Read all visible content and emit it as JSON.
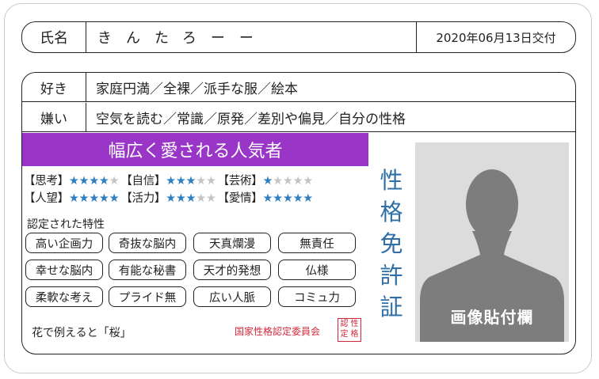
{
  "header": {
    "name_label": "氏名",
    "name_value": "きんたろーー",
    "issued": "2020年06月13日交付"
  },
  "likes": {
    "label": "好き",
    "value": "家庭円満／全裸／派手な服／絵本"
  },
  "dislikes": {
    "label": "嫌い",
    "value": "空気を読む／常識／原発／差別や偏見／自分の性格"
  },
  "banner": "幅広く愛される人気者",
  "ratings": [
    {
      "label": "【思考】",
      "stars": 4,
      "max": 5
    },
    {
      "label": "【自信】",
      "stars": 3,
      "max": 5
    },
    {
      "label": "【芸術】",
      "stars": 1,
      "max": 5
    },
    {
      "label": "【人望】",
      "stars": 5,
      "max": 5
    },
    {
      "label": "【活力】",
      "stars": 3,
      "max": 5
    },
    {
      "label": "【愛情】",
      "stars": 5,
      "max": 5
    }
  ],
  "traits_title": "認定された特性",
  "traits": [
    "高い企画力",
    "奇抜な脳内",
    "天真爛漫",
    "無責任",
    "幸せな脳内",
    "有能な秘書",
    "天才的発想",
    "仏様",
    "柔軟な考え",
    "プライド無",
    "広い人脈",
    "コミュ力"
  ],
  "flower": "花で例えると「桜」",
  "issuer": "国家性格認定委員会",
  "seal": [
    "認",
    "性",
    "定",
    "格"
  ],
  "vertical_title": [
    "性",
    "格",
    "免",
    "許",
    "証"
  ],
  "photo_label": "画像貼付欄",
  "colors": {
    "banner": "#9a36c7",
    "star_on": "#2f7fc1",
    "title": "#2f6fa8",
    "issuer": "#d0283a"
  }
}
